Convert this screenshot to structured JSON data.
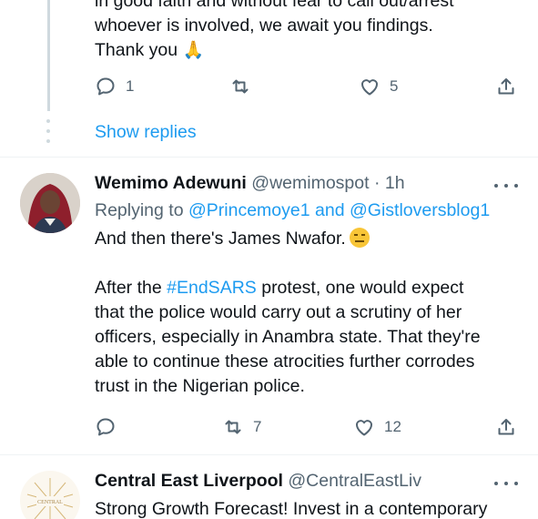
{
  "top_tweet": {
    "lines": [
      "in good faith and without fear to call out/arrest",
      "whoever is involved, we await you findings.",
      "Thank you"
    ],
    "thank_emoji": "🙏",
    "reply_count": "1",
    "retweet_count": "",
    "like_count": "5",
    "show_replies": "Show replies"
  },
  "tweet2": {
    "author_name": "Wemimo Adewuni",
    "handle": "@wemimospot",
    "separator": "·",
    "time": "1h",
    "replying_prefix": "Replying to",
    "reply_handle_1": "@Princemoye1",
    "reply_and": "and",
    "reply_handle_2": "@Gistloversblog1",
    "line1": "And then there's James Nwafor.",
    "para2_prefix": "After the",
    "hashtag": "#EndSARS",
    "para2_rest": "protest, one would expect",
    "para2_lines": [
      "that the police would carry out a scrutiny of her",
      "officers, especially in Anambra state. That they're",
      "able to continue these atrocities further corrodes",
      "trust in the Nigerian police."
    ],
    "reply_count": "",
    "retweet_count": "7",
    "like_count": "12"
  },
  "tweet3": {
    "author_name": "Central East Liverpool",
    "handle": "@CentralEastLiv",
    "text": "Strong Growth Forecast! Invest in a contemporary",
    "logo_text": "CENTRAL"
  },
  "colors": {
    "accent": "#1d9bf0",
    "muted": "#536471",
    "text": "#0f1419",
    "divider": "#eff3f4"
  }
}
